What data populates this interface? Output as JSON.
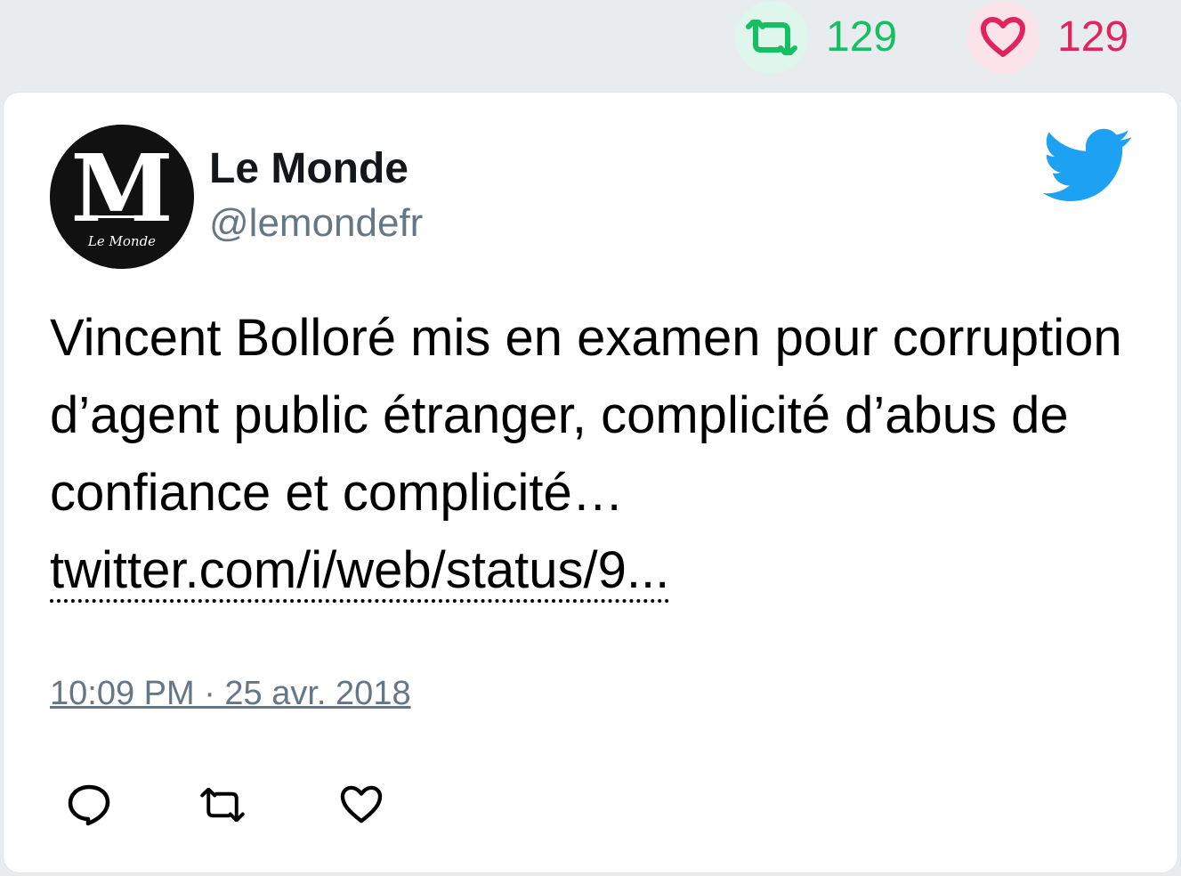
{
  "stats": {
    "retweet_count": "129",
    "like_count": "129",
    "retweet_color": "#17bf63",
    "like_color": "#e0245e"
  },
  "tweet": {
    "author_name": "Le Monde",
    "author_handle": "@lemondefr",
    "avatar_logo": "Le Monde",
    "text": "Vincent Bolloré mis en examen pour corruption d’agent public étranger, complicité d’abus de confiance et complicité…",
    "link_text": "twitter.com/i/web/status/9...",
    "timestamp": "10:09 PM · 25 avr. 2018"
  },
  "icons": {
    "brand": "twitter-bird-icon",
    "actions": [
      "reply-icon",
      "retweet-icon",
      "like-icon"
    ]
  }
}
